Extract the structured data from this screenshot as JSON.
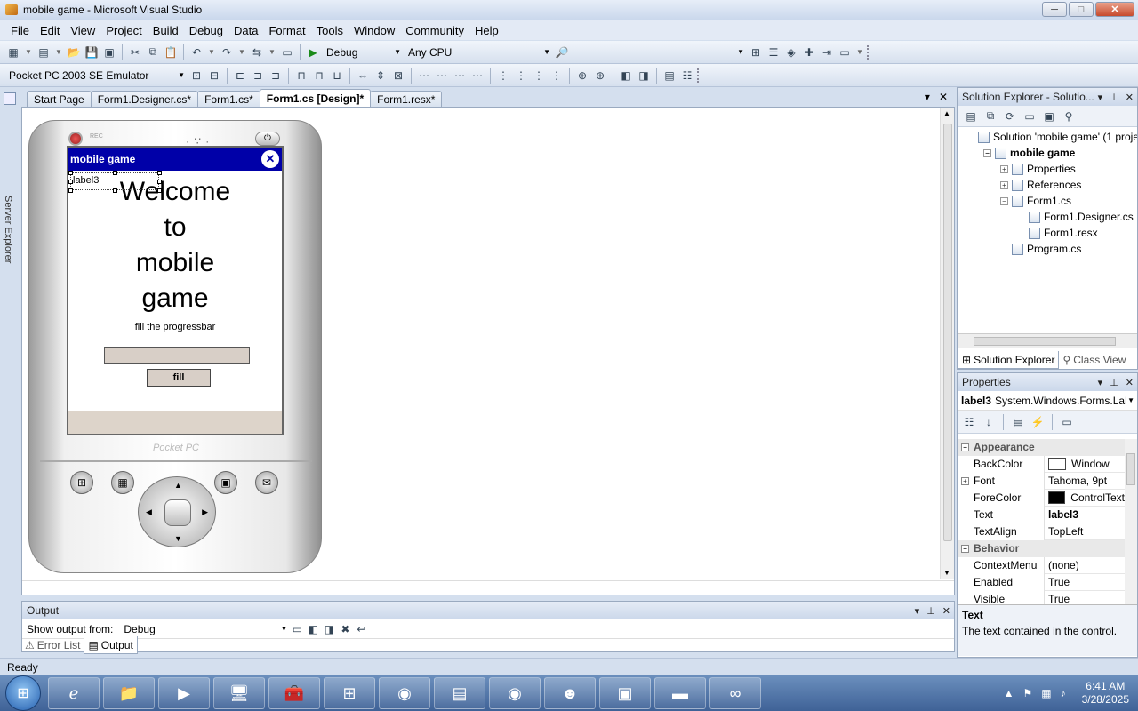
{
  "window": {
    "title": "mobile game - Microsoft Visual Studio",
    "min": "─",
    "max": "□",
    "close": "✕"
  },
  "menu": [
    "File",
    "Edit",
    "View",
    "Project",
    "Build",
    "Debug",
    "Data",
    "Format",
    "Tools",
    "Window",
    "Community",
    "Help"
  ],
  "toolbar": {
    "config": "Debug",
    "platform": "Any CPU",
    "device": "Pocket PC 2003 SE Emulator"
  },
  "left_strip": {
    "server_explorer": "Server Explorer",
    "plus": "+",
    "minus": "−"
  },
  "tabs": [
    "Start Page",
    "Form1.Designer.cs*",
    "Form1.cs*",
    "Form1.cs [Design]*",
    "Form1.resx*"
  ],
  "tabs_active_index": 3,
  "tab_controls": {
    "dropdown": "▾",
    "close": "✕"
  },
  "device": {
    "rec_label": "REC",
    "ppc_brand": "Pocket PC",
    "app_title": "mobile game",
    "close_glyph": "✕",
    "label3": "label3",
    "welcome_lines": [
      "Welcome",
      "to",
      "mobile",
      "game"
    ],
    "subtitle": "fill the progressbar",
    "progress": 0,
    "fill_button": "fill"
  },
  "solution_explorer": {
    "title": "Solution Explorer - Solutio...",
    "tree": [
      {
        "label": "Solution 'mobile game' (1 project)",
        "indent": 0,
        "bold": false,
        "exp": ""
      },
      {
        "label": "mobile game",
        "indent": 1,
        "bold": true,
        "exp": "−"
      },
      {
        "label": "Properties",
        "indent": 2,
        "bold": false,
        "exp": "+"
      },
      {
        "label": "References",
        "indent": 2,
        "bold": false,
        "exp": "+"
      },
      {
        "label": "Form1.cs",
        "indent": 2,
        "bold": false,
        "exp": "−"
      },
      {
        "label": "Form1.Designer.cs",
        "indent": 3,
        "bold": false,
        "exp": ""
      },
      {
        "label": "Form1.resx",
        "indent": 3,
        "bold": false,
        "exp": ""
      },
      {
        "label": "Program.cs",
        "indent": 2,
        "bold": false,
        "exp": ""
      }
    ],
    "tab_solution": "Solution Explorer",
    "tab_class": "Class View"
  },
  "properties": {
    "title": "Properties",
    "object_name": "label3",
    "object_type": "System.Windows.Forms.Lal",
    "rows": [
      {
        "kind": "cat",
        "label": "Appearance",
        "exp": "−"
      },
      {
        "kind": "prop",
        "label": "BackColor",
        "value": "Window",
        "swatch": "#ffffff"
      },
      {
        "kind": "prop",
        "label": "Font",
        "value": "Tahoma, 9pt",
        "exp": "+"
      },
      {
        "kind": "prop",
        "label": "ForeColor",
        "value": "ControlText",
        "swatch": "#000000"
      },
      {
        "kind": "prop",
        "label": "Text",
        "value": "label3",
        "bold": true
      },
      {
        "kind": "prop",
        "label": "TextAlign",
        "value": "TopLeft"
      },
      {
        "kind": "cat",
        "label": "Behavior",
        "exp": "−"
      },
      {
        "kind": "prop",
        "label": "ContextMenu",
        "value": "(none)"
      },
      {
        "kind": "prop",
        "label": "Enabled",
        "value": "True"
      },
      {
        "kind": "prop",
        "label": "Visible",
        "value": "True"
      }
    ],
    "desc_title": "Text",
    "desc_text": "The text contained in the control."
  },
  "output": {
    "title": "Output",
    "show_from_label": "Show output from:",
    "show_from_value": "Debug"
  },
  "bottom_tabs": [
    "Error List",
    "Output"
  ],
  "status": "Ready",
  "taskbar": {
    "time": "6:41 AM",
    "date": "3/28/2025"
  }
}
